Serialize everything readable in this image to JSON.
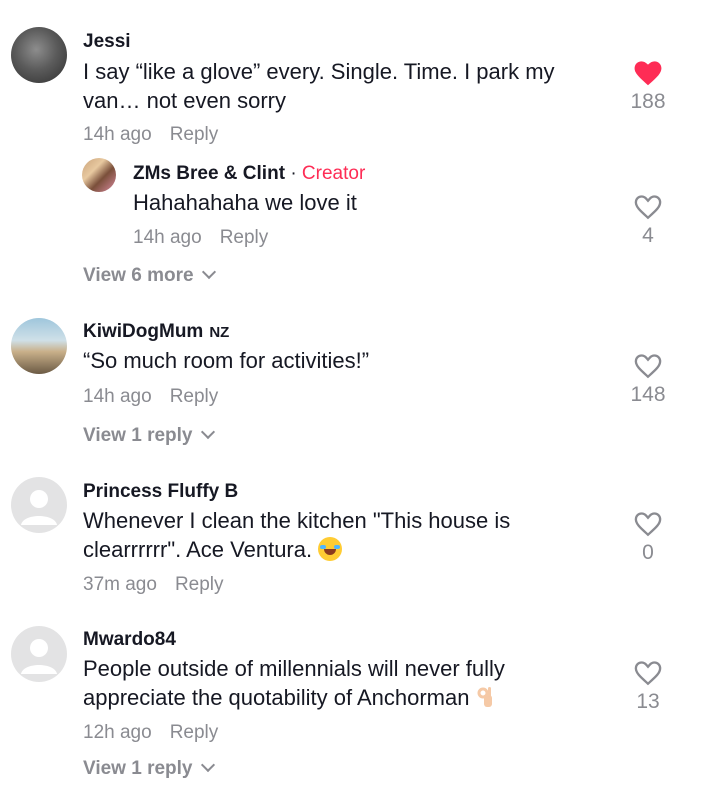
{
  "reply_label": "Reply",
  "comments": [
    {
      "username": "Jessi",
      "text": "I say “like a glove” every. Single. Time. I park my van… not even sorry",
      "time": "14h ago",
      "likes": "188",
      "liked": true,
      "replies": [
        {
          "username": "ZMs Bree & Clint",
          "separator": "·",
          "badge": "Creator",
          "text": "Hahahahaha we love it",
          "time": "14h ago",
          "likes": "4"
        }
      ],
      "view_more": "View 6 more"
    },
    {
      "username": "KiwiDogMum",
      "flag": "NZ",
      "text": "“So much room for activities!”",
      "time": "14h ago",
      "likes": "148",
      "view_more": "View 1 reply"
    },
    {
      "username": "Princess Fluffy B",
      "text": "Whenever I clean the kitchen \"This house is clearrrrrr\". Ace Ventura.",
      "emoji": "face-with-tears-of-joy",
      "time": "37m ago",
      "likes": "0"
    },
    {
      "username": "Mwardo84",
      "text": "People outside of millennials will never fully appreciate the quotability of Anchorman",
      "emoji": "ok-hand",
      "time": "12h ago",
      "likes": "13",
      "view_more": "View 1 reply"
    }
  ],
  "colors": {
    "heart_liked": "#fe2c55",
    "creator_badge": "#fe2c55",
    "muted": "#8a8b91",
    "text": "#161823"
  }
}
